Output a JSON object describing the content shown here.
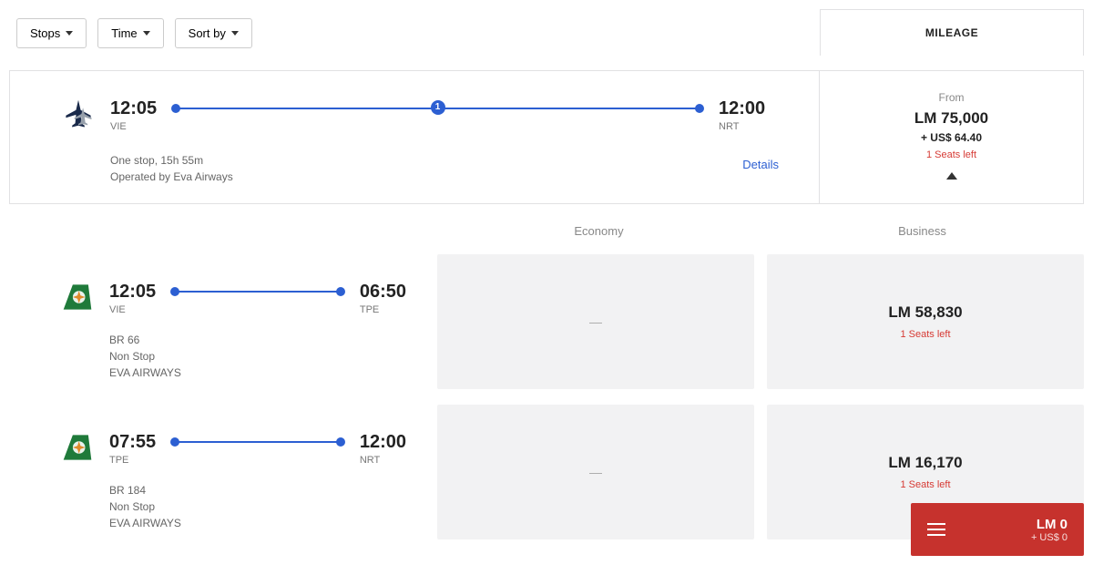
{
  "filters": {
    "stops": "Stops",
    "time": "Time",
    "sort": "Sort by"
  },
  "mileage_tab": "MILEAGE",
  "summary": {
    "departure_time": "12:05",
    "departure_code": "VIE",
    "stop_count": "1",
    "arrival_time": "12:00",
    "arrival_code": "NRT",
    "stops_text": "One stop, 15h 55m",
    "operated_by": "Operated by Eva Airways",
    "details": "Details"
  },
  "summary_price": {
    "from_label": "From",
    "price": "LM 75,000",
    "taxes": "+ US$ 64.40",
    "seats": "1 Seats left"
  },
  "class_headers": {
    "economy": "Economy",
    "business": "Business"
  },
  "segments": [
    {
      "dep_time": "12:05",
      "dep_code": "VIE",
      "arr_time": "06:50",
      "arr_code": "TPE",
      "flight_no": "BR 66",
      "stops": "Non Stop",
      "airline": "EVA AIRWAYS",
      "economy": {
        "empty": true,
        "dash": "—"
      },
      "business": {
        "price": "LM 58,830",
        "seats": "1 Seats left"
      }
    },
    {
      "dep_time": "07:55",
      "dep_code": "TPE",
      "arr_time": "12:00",
      "arr_code": "NRT",
      "flight_no": "BR 184",
      "stops": "Non Stop",
      "airline": "EVA AIRWAYS",
      "economy": {
        "empty": true,
        "dash": "—"
      },
      "business": {
        "price": "LM 16,170",
        "seats": "1 Seats left"
      }
    }
  ],
  "cart": {
    "total": "LM 0",
    "sub": "+ US$ 0"
  }
}
